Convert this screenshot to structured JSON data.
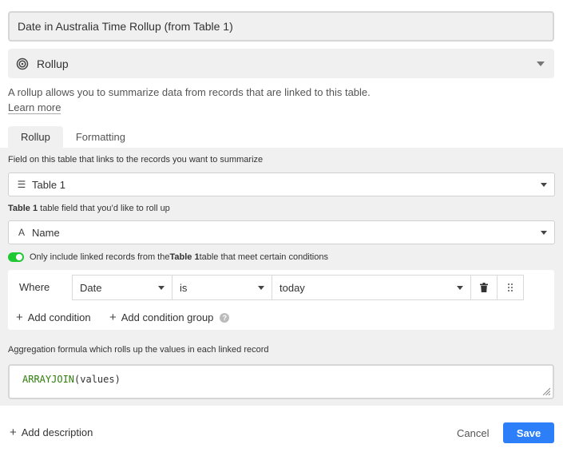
{
  "field_name": {
    "value": "Date in Australia Time Rollup (from Table 1)"
  },
  "field_type": {
    "label": "Rollup",
    "icon": "rollup-spiral-icon"
  },
  "description": {
    "text": "A rollup allows you to summarize data from records that are linked to this table.",
    "learn_more": "Learn more"
  },
  "tabs": [
    {
      "label": "Rollup",
      "active": true
    },
    {
      "label": "Formatting",
      "active": false
    }
  ],
  "link_field": {
    "label": "Field on this table that links to the records you want to summarize",
    "value": "Table 1",
    "icon": "linked-records-icon"
  },
  "rollup_field": {
    "label_table": "Table 1",
    "label_rest": " table field that you’d like to roll up",
    "value": "Name",
    "icon": "text-field-icon"
  },
  "conditions": {
    "toggle_on": true,
    "prefix": "Only include linked records from the ",
    "table": "Table 1",
    "suffix": " table that meet certain conditions",
    "where_label": "Where",
    "field": "Date",
    "operator": "is",
    "value": "today",
    "add_condition": "Add condition",
    "add_condition_group": "Add condition group"
  },
  "aggregation": {
    "label": "Aggregation formula which rolls up the values in each linked record",
    "function": "ARRAYJOIN",
    "args": "(values)"
  },
  "footer": {
    "add_description": "Add description",
    "cancel": "Cancel",
    "save": "Save"
  },
  "colors": {
    "accent": "#2d7ff9",
    "toggle": "#20c933",
    "formula_fn": "#2e7d0b"
  }
}
